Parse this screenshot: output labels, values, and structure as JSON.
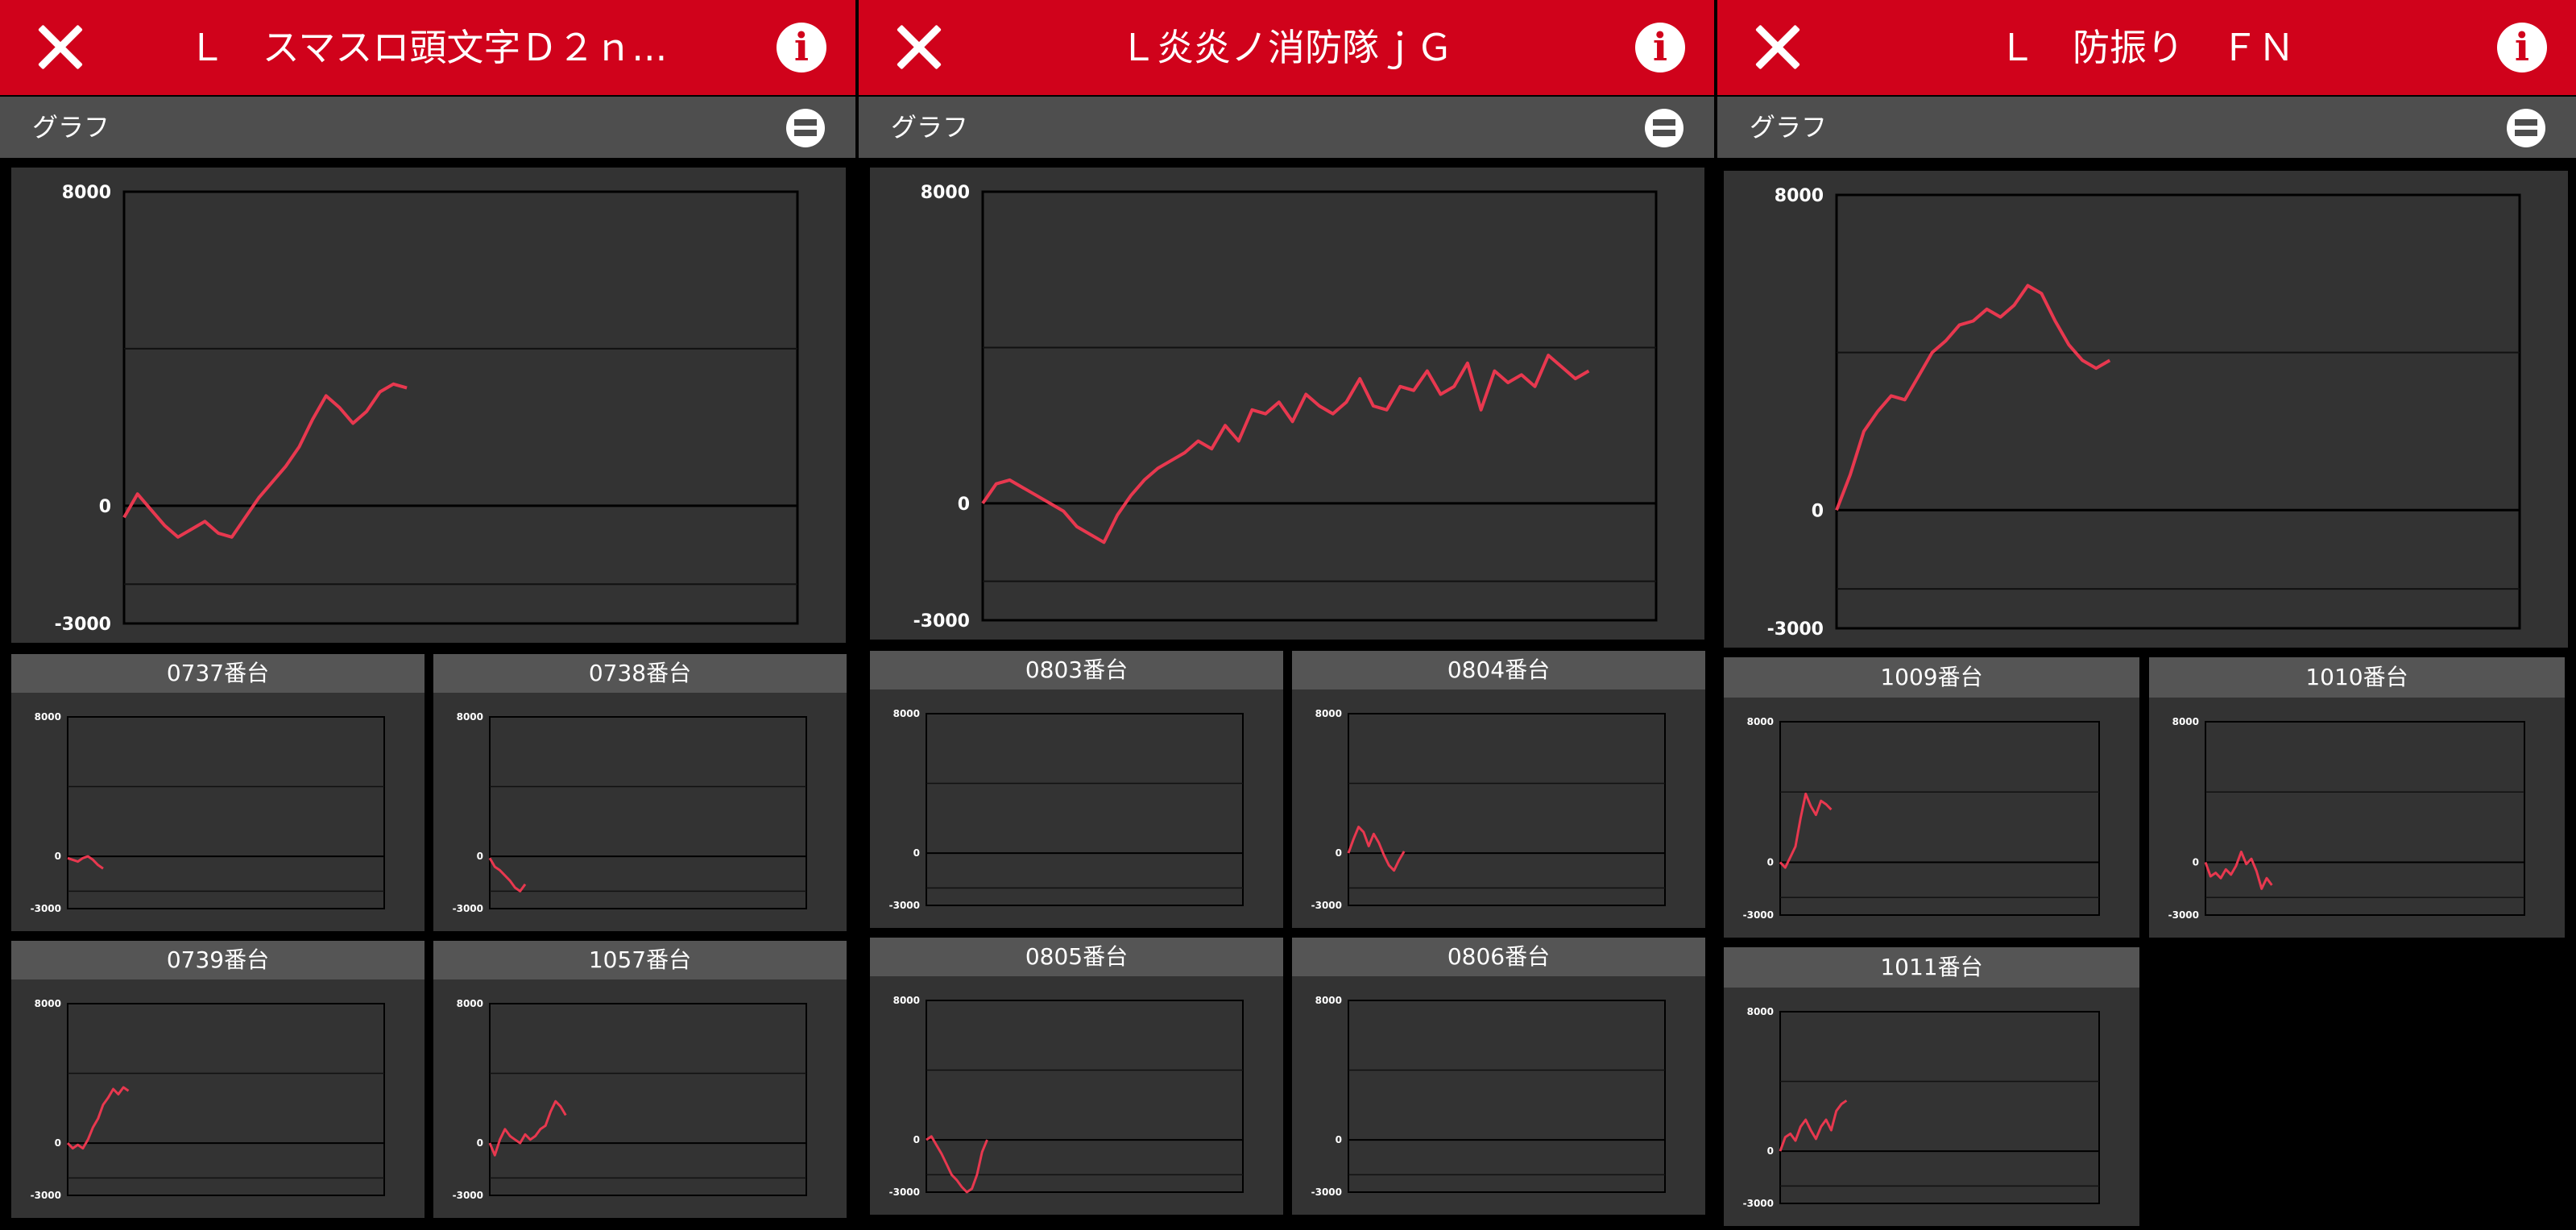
{
  "colors": {
    "header": "#d0021b",
    "subbar": "#4e4e4e",
    "line": "#e8384f",
    "plot_bg": "#333333"
  },
  "panels": [
    {
      "title": "Ｌ　スマスロ頭文字Ｄ２ｎ...",
      "section": "グラフ",
      "chart_data": [
        {
          "type": "line",
          "role": "main",
          "ylim": [
            -3000,
            8000
          ],
          "yticks": [
            "8000",
            "0",
            "-3000"
          ],
          "series": [
            {
              "values": [
                -300,
                300,
                -100,
                -500,
                -800,
                -600,
                -400,
                -700,
                -800,
                -300,
                200,
                600,
                1000,
                1500,
                2200,
                2800,
                2500,
                2100,
                2400,
                2900,
                3100,
                3000
              ]
            }
          ]
        },
        {
          "type": "line",
          "title": "0737番台",
          "ylim": [
            -3000,
            8000
          ],
          "yticks": [
            "8000",
            "0",
            "-3000"
          ],
          "series": [
            {
              "values": [
                -100,
                -200,
                -300,
                -100,
                0,
                -200,
                -500,
                -700
              ]
            }
          ]
        },
        {
          "type": "line",
          "title": "0738番台",
          "ylim": [
            -3000,
            8000
          ],
          "yticks": [
            "8000",
            "0",
            "-3000"
          ],
          "series": [
            {
              "values": [
                -100,
                -600,
                -800,
                -1100,
                -1400,
                -1800,
                -2000,
                -1600
              ]
            }
          ]
        },
        {
          "type": "line",
          "title": "0739番台",
          "ylim": [
            -3000,
            8000
          ],
          "yticks": [
            "8000",
            "0",
            "-3000"
          ],
          "series": [
            {
              "values": [
                0,
                -300,
                -100,
                -300,
                200,
                900,
                1400,
                2200,
                2600,
                3100,
                2800,
                3200,
                3000
              ]
            }
          ]
        },
        {
          "type": "line",
          "title": "1057番台",
          "ylim": [
            -3000,
            8000
          ],
          "yticks": [
            "8000",
            "0",
            "-3000"
          ],
          "series": [
            {
              "values": [
                0,
                -700,
                200,
                800,
                400,
                200,
                0,
                500,
                200,
                400,
                800,
                1000,
                1800,
                2400,
                2100,
                1600
              ]
            }
          ]
        }
      ]
    },
    {
      "title": "Ｌ炎炎ノ消防隊ｊＧ",
      "section": "グラフ",
      "chart_data": [
        {
          "type": "line",
          "role": "main",
          "ylim": [
            -3000,
            8000
          ],
          "yticks": [
            "8000",
            "0",
            "-3000"
          ],
          "series": [
            {
              "values": [
                0,
                500,
                600,
                400,
                200,
                0,
                -200,
                -600,
                -800,
                -1000,
                -300,
                200,
                600,
                900,
                1100,
                1300,
                1600,
                1400,
                2000,
                1600,
                2400,
                2300,
                2600,
                2100,
                2800,
                2500,
                2300,
                2600,
                3200,
                2500,
                2400,
                3000,
                2900,
                3400,
                2800,
                3000,
                3600,
                2400,
                3400,
                3100,
                3300,
                3000,
                3800,
                3500,
                3200,
                3400
              ]
            }
          ]
        },
        {
          "type": "line",
          "title": "0803番台",
          "ylim": [
            -3000,
            8000
          ],
          "yticks": [
            "8000",
            "0",
            "-3000"
          ],
          "series": [
            {
              "values": []
            }
          ]
        },
        {
          "type": "line",
          "title": "0804番台",
          "ylim": [
            -3000,
            8000
          ],
          "yticks": [
            "8000",
            "0",
            "-3000"
          ],
          "series": [
            {
              "values": [
                0,
                800,
                1500,
                1200,
                400,
                1100,
                600,
                -100,
                -700,
                -1000,
                -400,
                100
              ]
            }
          ]
        },
        {
          "type": "line",
          "title": "0805番台",
          "ylim": [
            -3000,
            8000
          ],
          "yticks": [
            "8000",
            "0",
            "-3000"
          ],
          "series": [
            {
              "values": [
                0,
                200,
                -300,
                -800,
                -1400,
                -2000,
                -2300,
                -2700,
                -3000,
                -2800,
                -2000,
                -700,
                0
              ]
            }
          ]
        },
        {
          "type": "line",
          "title": "0806番台",
          "ylim": [
            -3000,
            8000
          ],
          "yticks": [
            "8000",
            "0",
            "-3000"
          ],
          "series": [
            {
              "values": []
            }
          ]
        }
      ]
    },
    {
      "title": "Ｌ　防振り　ＦＮ",
      "section": "グラフ",
      "chart_data": [
        {
          "type": "line",
          "role": "main",
          "ylim": [
            -3000,
            8000
          ],
          "yticks": [
            "8000",
            "0",
            "-3000"
          ],
          "series": [
            {
              "values": [
                0,
                900,
                2000,
                2500,
                2900,
                2800,
                3400,
                4000,
                4300,
                4700,
                4800,
                5100,
                4900,
                5200,
                5700,
                5500,
                4800,
                4200,
                3800,
                3600,
                3800
              ]
            }
          ]
        },
        {
          "type": "line",
          "title": "1009番台",
          "ylim": [
            -3000,
            8000
          ],
          "yticks": [
            "8000",
            "0",
            "-3000"
          ],
          "series": [
            {
              "values": [
                0,
                -300,
                300,
                900,
                2500,
                3900,
                3200,
                2700,
                3500,
                3300,
                3000
              ]
            }
          ]
        },
        {
          "type": "line",
          "title": "1010番台",
          "ylim": [
            -3000,
            8000
          ],
          "yticks": [
            "8000",
            "0",
            "-3000"
          ],
          "series": [
            {
              "values": [
                0,
                -800,
                -600,
                -900,
                -400,
                -700,
                -200,
                600,
                -100,
                200,
                -500,
                -1500,
                -900,
                -1300
              ]
            }
          ]
        },
        {
          "type": "line",
          "title": "1011番台",
          "ylim": [
            -3000,
            8000
          ],
          "yticks": [
            "8000",
            "0",
            "-3000"
          ],
          "series": [
            {
              "values": [
                0,
                800,
                1000,
                600,
                1400,
                1800,
                1200,
                700,
                1400,
                1800,
                1200,
                2300,
                2700,
                2900
              ]
            }
          ]
        }
      ]
    }
  ]
}
